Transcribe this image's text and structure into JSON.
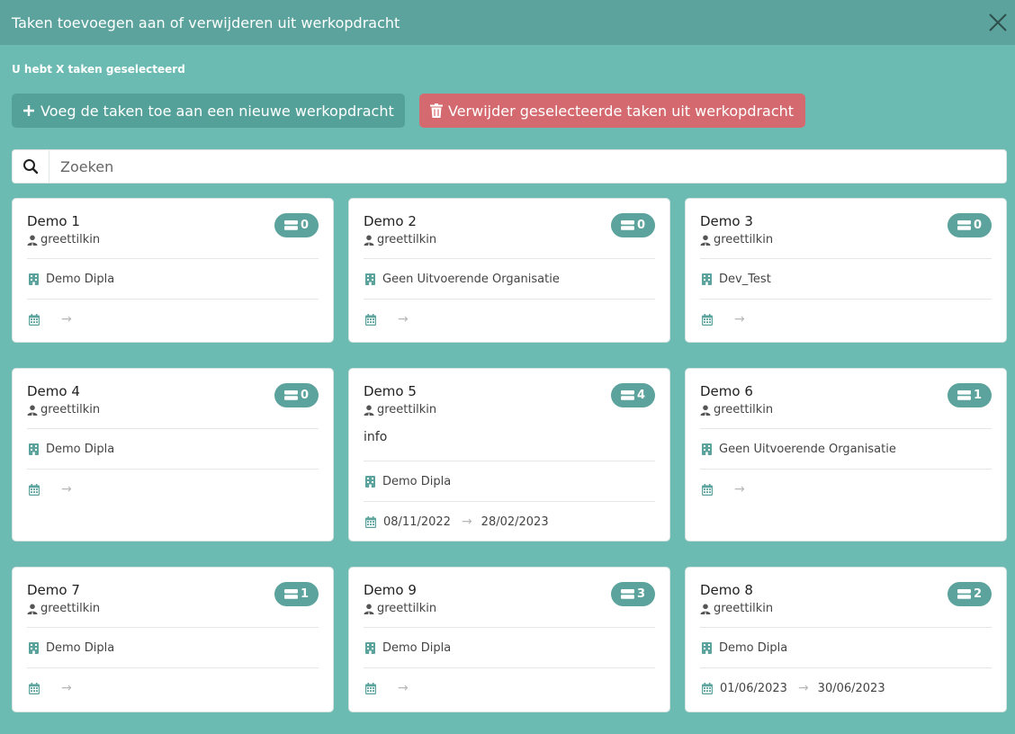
{
  "dialog": {
    "title": "Taken toevoegen aan of verwijderen uit werkopdracht",
    "subtitle": "U hebt X taken geselecteerd",
    "add_button": "Voeg de taken toe aan een nieuwe werkopdracht",
    "delete_button": "Verwijder geselecteerde taken uit werkopdracht",
    "search_placeholder": "Zoeken"
  },
  "colors": {
    "background": "#6bbbb3",
    "titlebar": "#5ba39c",
    "accent": "#5ba39c",
    "add_button": "#54a199",
    "delete_button": "#d46a6f"
  },
  "cards": [
    {
      "name": "Demo 1",
      "user": "greettilkin",
      "count": "0",
      "info": "",
      "org": "Demo Dipla",
      "start": "",
      "end": ""
    },
    {
      "name": "Demo 2",
      "user": "greettilkin",
      "count": "0",
      "info": "",
      "org": "Geen Uitvoerende Organisatie",
      "start": "",
      "end": ""
    },
    {
      "name": "Demo 3",
      "user": "greettilkin",
      "count": "0",
      "info": "",
      "org": "Dev_Test",
      "start": "",
      "end": ""
    },
    {
      "name": "Demo 4",
      "user": "greettilkin",
      "count": "0",
      "info": "",
      "org": "Demo Dipla",
      "start": "",
      "end": ""
    },
    {
      "name": "Demo 5",
      "user": "greettilkin",
      "count": "4",
      "info": "info",
      "org": "Demo Dipla",
      "start": "08/11/2022",
      "end": "28/02/2023"
    },
    {
      "name": "Demo 6",
      "user": "greettilkin",
      "count": "1",
      "info": "",
      "org": "Geen Uitvoerende Organisatie",
      "start": "",
      "end": ""
    },
    {
      "name": "Demo 7",
      "user": "greettilkin",
      "count": "1",
      "info": "",
      "org": "Demo Dipla",
      "start": "",
      "end": ""
    },
    {
      "name": "Demo 9",
      "user": "greettilkin",
      "count": "3",
      "info": "",
      "org": "Demo Dipla",
      "start": "",
      "end": ""
    },
    {
      "name": "Demo 8",
      "user": "greettilkin",
      "count": "2",
      "info": "",
      "org": "Demo Dipla",
      "start": "01/06/2023",
      "end": "30/06/2023"
    }
  ],
  "arrow_glyph": "→",
  "icons": {
    "close": "close-icon",
    "add": "plus-icon",
    "delete": "trash-icon",
    "search": "search-icon",
    "user": "user-icon",
    "badge": "server-icon",
    "org": "building-icon",
    "date": "calendar-icon"
  }
}
